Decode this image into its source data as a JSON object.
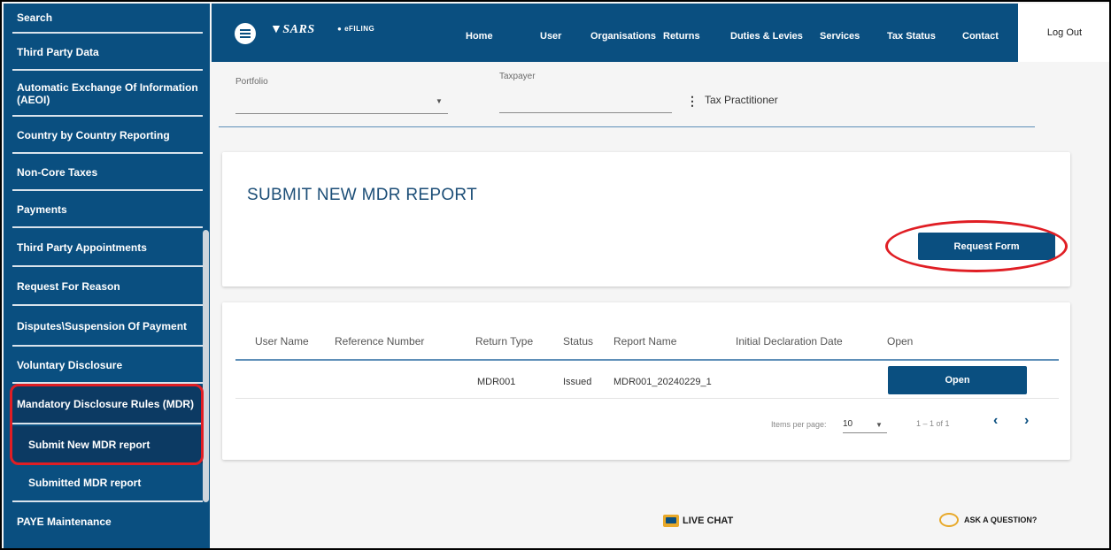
{
  "sidebar": {
    "items": [
      {
        "label": "Search"
      },
      {
        "label": "Third Party Data"
      },
      {
        "label": "Automatic Exchange Of Information (AEOI)"
      },
      {
        "label": "Country by Country Reporting"
      },
      {
        "label": "Non-Core Taxes"
      },
      {
        "label": "Payments"
      },
      {
        "label": "Third Party Appointments"
      },
      {
        "label": "Request For Reason"
      },
      {
        "label": "Disputes\\Suspension Of Payment"
      },
      {
        "label": "Voluntary Disclosure"
      },
      {
        "label": "Mandatory Disclosure Rules (MDR)"
      },
      {
        "label": "Submit New MDR report"
      },
      {
        "label": "Submitted MDR report"
      },
      {
        "label": "PAYE Maintenance"
      }
    ]
  },
  "topnav": {
    "logo": "SARS",
    "efiling": "eFILING",
    "items": [
      "Home",
      "User",
      "Organisations",
      "Returns",
      "Duties & Levies",
      "Services",
      "Tax Status",
      "Contact"
    ],
    "logout": "Log Out"
  },
  "filters": {
    "portfolio_label": "Portfolio",
    "taxpayer_label": "Taxpayer",
    "taxpayer_value": "Tax Practitioner"
  },
  "report_card": {
    "title": "SUBMIT NEW MDR REPORT",
    "request_button": "Request Form"
  },
  "table": {
    "headers": [
      "User Name",
      "Reference Number",
      "Return Type",
      "Status",
      "Report Name",
      "Initial Declaration Date",
      "Open"
    ],
    "rows": [
      {
        "user_name": "",
        "reference_number": "",
        "return_type": "MDR001",
        "status": "Issued",
        "report_name": "MDR001_20240229_1",
        "initial_declaration_date": "",
        "open_label": "Open"
      }
    ],
    "items_per_page_label": "Items per page:",
    "items_per_page": "10",
    "range": "1 – 1 of 1"
  },
  "footer": {
    "live_chat": "LIVE CHAT",
    "ask_question": "ASK A QUESTION?"
  },
  "colors": {
    "primary": "#0a4f80",
    "highlight": "#e01e24",
    "accent": "#e8a92a"
  }
}
